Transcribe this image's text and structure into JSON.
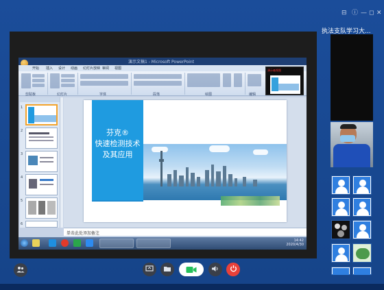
{
  "window": {
    "controls": [
      "⊟",
      "ⓘ",
      "—",
      "◻",
      "✕"
    ],
    "meeting_title": "执法支队学习大..."
  },
  "office": {
    "title": "演示文稿1 - Microsoft PowerPoint",
    "tabs": [
      "开始",
      "插入",
      "设计",
      "动画",
      "幻灯片放映",
      "审阅",
      "视图"
    ],
    "groups": [
      "剪贴板",
      "幻灯片",
      "字体",
      "段落",
      "绘图",
      "编辑"
    ],
    "preview_label": "演示者视图",
    "notes_placeholder": "单击此处添加备注",
    "clock": {
      "time": "14:42",
      "date": "2020/4/30"
    }
  },
  "slide": {
    "title_line1": "芬克®",
    "title_line2": "快速检测技术",
    "title_line3": "及其应用"
  },
  "slides_pane": {
    "numbers": [
      "1",
      "2",
      "3",
      "4",
      "5",
      "6"
    ]
  },
  "controls": {
    "participants_icon": "people-icon",
    "share_icon": "share-icon",
    "files_icon": "folder-icon",
    "camera_icon": "camera-icon",
    "speaker_icon": "speaker-icon",
    "end_icon": "power-icon"
  },
  "colors": {
    "frame": "#1b4d9a",
    "slide_blue": "#1f9be0",
    "end_call": "#e8413a",
    "camera_green": "#25c05a"
  }
}
